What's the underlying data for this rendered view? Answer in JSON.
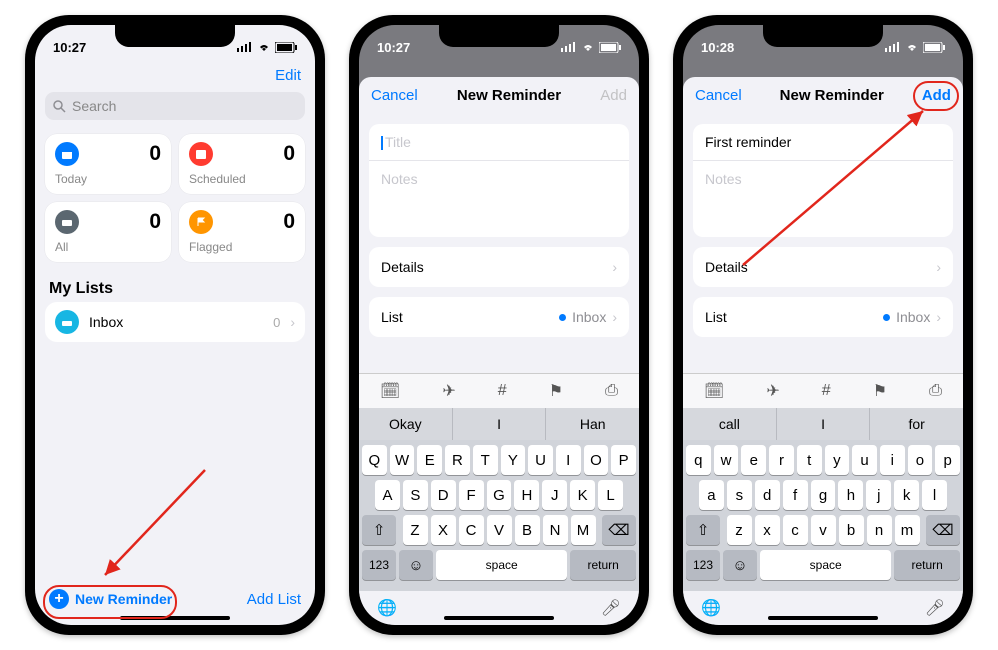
{
  "phone1": {
    "time": "10:27",
    "edit": "Edit",
    "search_placeholder": "Search",
    "cards": {
      "today": {
        "label": "Today",
        "count": "0"
      },
      "scheduled": {
        "label": "Scheduled",
        "count": "0"
      },
      "all": {
        "label": "All",
        "count": "0"
      },
      "flagged": {
        "label": "Flagged",
        "count": "0"
      }
    },
    "mylists_header": "My Lists",
    "inbox_label": "Inbox",
    "inbox_count": "0",
    "new_reminder": "New Reminder",
    "add_list": "Add List"
  },
  "phone2": {
    "time": "10:27",
    "cancel": "Cancel",
    "title": "New Reminder",
    "add": "Add",
    "title_placeholder": "Title",
    "notes_placeholder": "Notes",
    "details": "Details",
    "list_label": "List",
    "list_value": "Inbox",
    "suggestions": [
      "Okay",
      "I",
      "Han"
    ],
    "keyboard": {
      "row1": [
        "Q",
        "W",
        "E",
        "R",
        "T",
        "Y",
        "U",
        "I",
        "O",
        "P"
      ],
      "row2": [
        "A",
        "S",
        "D",
        "F",
        "G",
        "H",
        "J",
        "K",
        "L"
      ],
      "row3": [
        "Z",
        "X",
        "C",
        "V",
        "B",
        "N",
        "M"
      ],
      "num": "123",
      "space": "space",
      "return": "return"
    }
  },
  "phone3": {
    "time": "10:28",
    "cancel": "Cancel",
    "title": "New Reminder",
    "add": "Add",
    "title_value": "First reminder",
    "notes_placeholder": "Notes",
    "details": "Details",
    "list_label": "List",
    "list_value": "Inbox",
    "suggestions": [
      "call",
      "I",
      "for"
    ],
    "keyboard": {
      "row1": [
        "q",
        "w",
        "e",
        "r",
        "t",
        "y",
        "u",
        "i",
        "o",
        "p"
      ],
      "row2": [
        "a",
        "s",
        "d",
        "f",
        "g",
        "h",
        "j",
        "k",
        "l"
      ],
      "row3": [
        "z",
        "x",
        "c",
        "v",
        "b",
        "n",
        "m"
      ],
      "num": "123",
      "space": "space",
      "return": "return"
    }
  }
}
